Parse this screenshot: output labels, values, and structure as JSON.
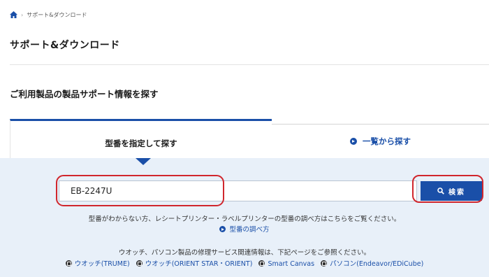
{
  "breadcrumb": {
    "home_icon": "home-icon",
    "separator": "›",
    "current": "サポート&ダウンロード"
  },
  "page_title": "サポート&ダウンロード",
  "section_title": "ご利用製品の製品サポート情報を探す",
  "tabs": [
    {
      "label": "型番を指定して探す",
      "active": true
    },
    {
      "label": "一覧から探す",
      "active": false,
      "icon": "circle-arrow-icon"
    }
  ],
  "search": {
    "value": "EB-2247U",
    "placeholder": "",
    "button_label": "検索",
    "button_icon": "search-icon"
  },
  "help": {
    "text": "型番がわからない方、レシートプリンター・ラベルプリンターの型番の調べ方はこちらをご覧ください。",
    "link": "型番の調べ方"
  },
  "repair": {
    "text": "ウオッチ、パソコン製品の修理サービス関連情報は、下記ページをご参照ください。",
    "links": [
      "ウオッチ(TRUME)",
      "ウオッチ(ORIENT STAR・ORIENT)",
      "Smart Canvas",
      "パソコン(Endeavor/EDiCube)"
    ]
  },
  "colors": {
    "accent": "#1a4fa8",
    "panel": "#e8f0f9",
    "highlight": "#d0262d"
  }
}
